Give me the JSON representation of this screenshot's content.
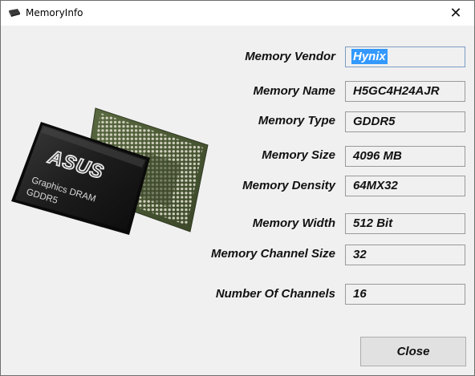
{
  "window": {
    "title": "MemoryInfo",
    "close_glyph": "✕"
  },
  "chip": {
    "brand": "ASUS",
    "line1": "Graphics DRAM",
    "line2": "GDDR5",
    "colors": {
      "package": "#1b1b1b",
      "board": "#4a5a33",
      "pad": "#c9c9b7"
    }
  },
  "fields": [
    {
      "label": "Memory Vendor",
      "value": "Hynix"
    },
    {
      "label": "Memory Name",
      "value": "H5GC4H24AJR"
    },
    {
      "label": "Memory Type",
      "value": "GDDR5"
    },
    {
      "label": "Memory Size",
      "value": "4096 MB"
    },
    {
      "label": "Memory Density",
      "value": "64MX32"
    },
    {
      "label": "Memory Width",
      "value": "512 Bit"
    },
    {
      "label": "Memory Channel Size",
      "value": "32"
    },
    {
      "label": "Number Of Channels",
      "value": "16"
    }
  ],
  "buttons": {
    "close_label": "Close"
  },
  "colors": {
    "selection": "#3399ff",
    "window_bg": "#f0f0f0"
  }
}
